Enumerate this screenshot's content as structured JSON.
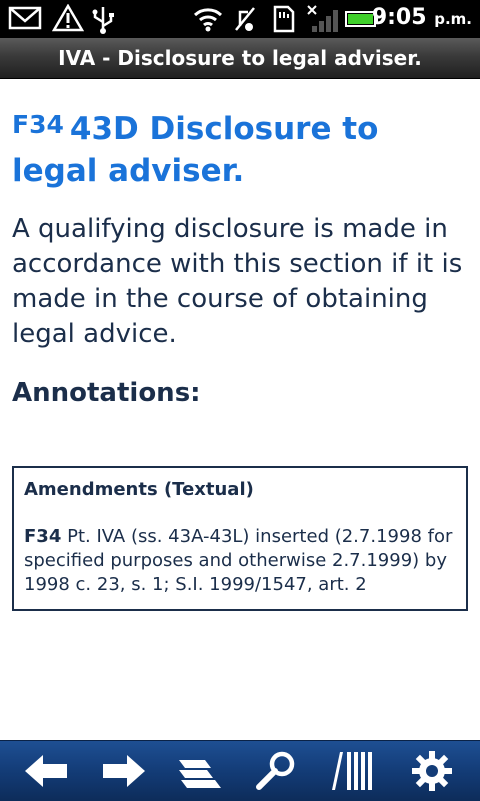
{
  "status_bar": {
    "time": "9:05",
    "ampm": "p.m.",
    "icons": [
      "gmail-icon",
      "warning-icon",
      "usb-icon",
      "wifi-icon",
      "vibrate-icon",
      "sd-card-icon",
      "signal-icon",
      "battery-icon"
    ]
  },
  "title_bar": {
    "title": "IVA - Disclosure to legal adviser."
  },
  "main": {
    "heading_ref": "F34",
    "heading": "43D Disclosure to legal adviser.",
    "body": "A qualifying disclosure is made in accordance with this section if it is made in the course of obtaining legal advice.",
    "annotations_title": "Annotations:",
    "annotations": {
      "header": "Amendments (Textual)",
      "note_ref": "F34",
      "note_text": "Pt. IVA (ss. 43A-43L) inserted (2.7.1998 for specified purposes and otherwise 2.7.1999) by 1998 c. 23, s. 1; S.I. 1999/1547, art. 2"
    }
  },
  "toolbar": {
    "buttons": [
      "back-arrow-icon",
      "forward-arrow-icon",
      "contents-icon",
      "search-icon",
      "library-icon",
      "settings-gear-icon"
    ]
  },
  "colors": {
    "heading": "#1a73d9",
    "text": "#1b2e4a",
    "toolbar": "#133c77"
  }
}
